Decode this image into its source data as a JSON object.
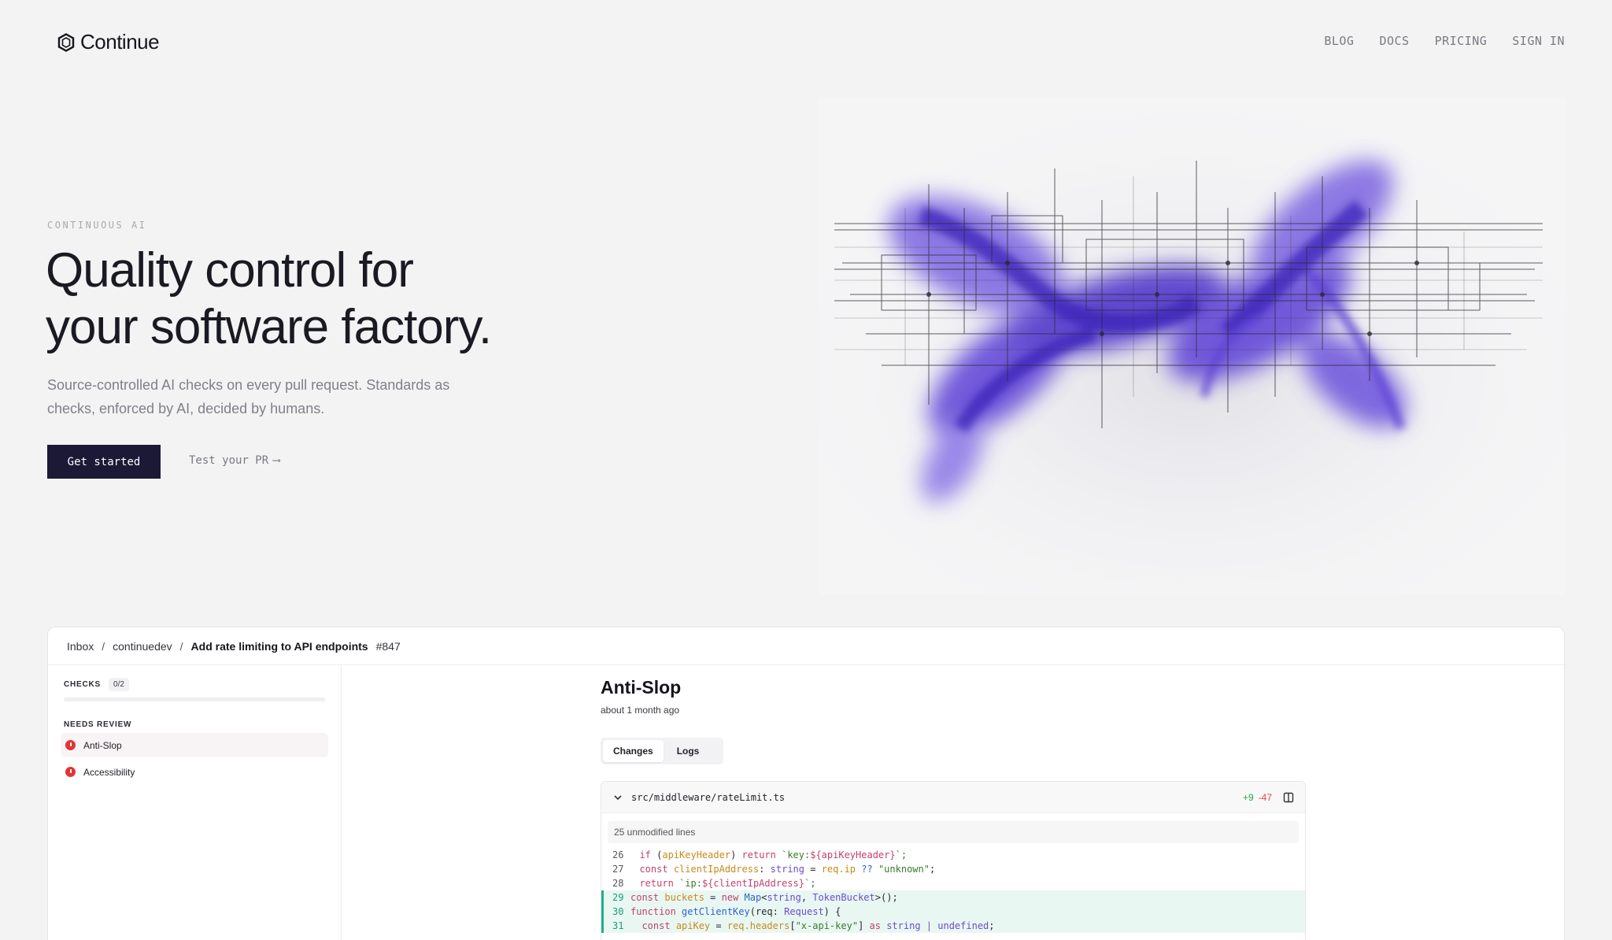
{
  "nav": {
    "brand": "Continue",
    "links": [
      "BLOG",
      "DOCS",
      "PRICING",
      "SIGN IN"
    ]
  },
  "hero": {
    "eyebrow": "CONTINUOUS AI",
    "headline_line1": "Quality control for",
    "headline_line2": "your software factory.",
    "subhead": "Source-controlled AI checks on every pull request. Standards as checks, enforced by AI, decided by humans.",
    "cta_primary": "Get started",
    "cta_secondary": "Test your PR",
    "cta_secondary_arrow": "⟶"
  },
  "panel": {
    "breadcrumb": {
      "inbox": "Inbox",
      "sep": "/",
      "org": "continuedev",
      "title": "Add rate limiting to API endpoints",
      "number": "#847"
    },
    "sidebar": {
      "checks_label": "CHECKS",
      "checks_count": "0/2",
      "progress": 0,
      "needs_review_label": "NEEDS REVIEW",
      "items": [
        {
          "label": "Anti-Slop",
          "status": "failed"
        },
        {
          "label": "Accessibility",
          "status": "failed"
        }
      ]
    },
    "main": {
      "title": "Anti-Slop",
      "time": "about 1 month ago",
      "tabs": [
        "Changes",
        "Logs"
      ],
      "diff": {
        "file": "src/middleware/rateLimit.ts",
        "additions": "+9",
        "deletions": "-47",
        "unmodified": "25 unmodified lines",
        "lines": [
          {
            "n": "26",
            "added": false
          },
          {
            "n": "27",
            "added": false
          },
          {
            "n": "28",
            "added": false
          },
          {
            "n": "29",
            "added": true
          },
          {
            "n": "30",
            "added": true
          },
          {
            "n": "31",
            "added": true
          }
        ],
        "code": {
          "l26": {
            "a": "  ",
            "b": "if",
            "c": " (",
            "d": "apiKeyHeader",
            "e": ") ",
            "f": "return",
            "g": " `key:",
            "h": "${apiKeyHeader}",
            "i": "`;"
          },
          "l27": {
            "a": "  ",
            "b": "const",
            "c": " ",
            "d": "clientIpAddress",
            "e": ": ",
            "f": "string",
            "g": " = ",
            "h": "req.ip",
            "i": " ?? ",
            "j": "\"unknown\"",
            "k": ";"
          },
          "l28": {
            "a": "  ",
            "b": "return",
            "c": " `ip:",
            "d": "${clientIpAddress}",
            "e": "`;"
          },
          "l29": {
            "a": "",
            "b": "const",
            "c": " ",
            "d": "buckets",
            "e": " = ",
            "f": "new",
            "g": " ",
            "h": "Map",
            "i": "<",
            "j": "string",
            "k": ", ",
            "l": "TokenBucket",
            "m": ">();"
          },
          "l30": {
            "a": "",
            "b": "function",
            "c": " ",
            "d": "getClientKey",
            "e": "(req: ",
            "f": "Request",
            "g": ") {"
          },
          "l31": {
            "a": "  ",
            "b": "const",
            "c": " ",
            "d": "apiKey",
            "e": " = ",
            "f": "req.headers",
            "g": "[",
            "h": "\"x-api-key\"",
            "i": "] ",
            "j": "as",
            "k": " ",
            "l": "string",
            "m": " | ",
            "n": "undefined",
            "o": ";"
          }
        }
      }
    }
  },
  "colors": {
    "accent": "#1c1936",
    "ink": "#5b3fd6",
    "fail": "#e23535",
    "added": "#1fb08a"
  }
}
